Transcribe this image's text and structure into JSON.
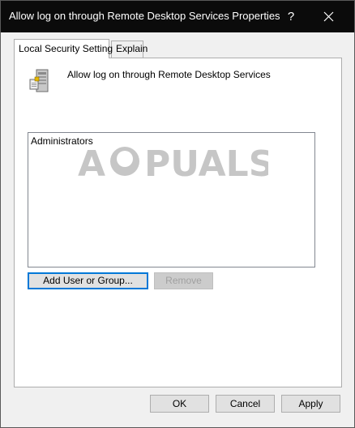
{
  "window": {
    "title": "Allow log on through Remote Desktop Services Properties",
    "help_glyph": "?",
    "close_icon": "close-icon"
  },
  "tabs": [
    {
      "label": "Local Security Setting",
      "active": true
    },
    {
      "label": "Explain",
      "active": false
    }
  ],
  "policy": {
    "icon": "server-icon",
    "title": "Allow log on through Remote Desktop Services"
  },
  "list": {
    "items": [
      "Administrators"
    ]
  },
  "watermark": {
    "text": "A PUALS"
  },
  "buttons": {
    "add": "Add User or Group...",
    "remove": "Remove",
    "ok": "OK",
    "cancel": "Cancel",
    "apply": "Apply"
  },
  "colors": {
    "titlebar": "#0b0b0b",
    "focus_accent": "#0078d7",
    "disabled_text": "#a0a0a0"
  }
}
